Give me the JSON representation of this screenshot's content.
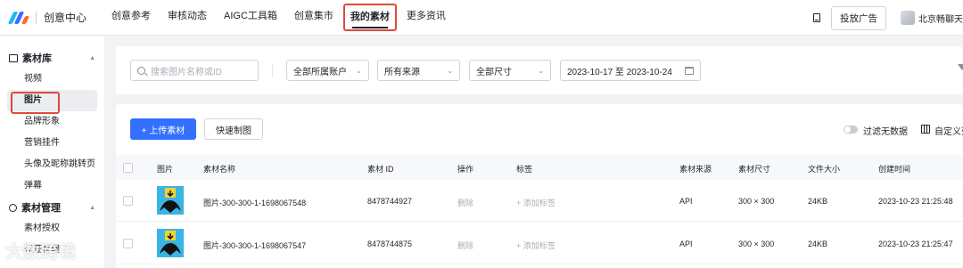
{
  "app": {
    "title": "创意中心",
    "colors": {
      "accent": "#3370ff",
      "highlight": "#e0483b",
      "logo": [
        "#1fb6ff",
        "#3370ff",
        "#fe6b33"
      ]
    }
  },
  "nav": {
    "items": [
      {
        "label": "创意参考"
      },
      {
        "label": "审核动态"
      },
      {
        "label": "AIGC工具箱"
      },
      {
        "label": "创意集市"
      },
      {
        "label": "我的素材",
        "active": true
      },
      {
        "label": "更多资讯"
      }
    ]
  },
  "header_right": {
    "device_icon": "tablet-icon",
    "ad_button": "投放广告",
    "account_name": "北京畅聊天下"
  },
  "sidebar": {
    "sections": [
      {
        "label": "素材库",
        "icon": "image-icon",
        "items": [
          {
            "label": "视频"
          },
          {
            "label": "图片",
            "active": true
          },
          {
            "label": "品牌形象"
          },
          {
            "label": "营销挂件"
          },
          {
            "label": "头像及昵称跳转页"
          },
          {
            "label": "弹幕"
          }
        ]
      },
      {
        "label": "素材管理",
        "icon": "gear-icon",
        "items": [
          {
            "label": "素材授权"
          },
          {
            "label": "标签管理"
          }
        ]
      }
    ]
  },
  "filters": {
    "search_placeholder": "搜索图片名称或ID",
    "account": "全部所属账户",
    "source": "所有来源",
    "size": "全部尺寸",
    "date_range": "2023-10-17 至 2023-10-24"
  },
  "toolbar": {
    "upload_label": "+ 上传素材",
    "quick_label": "快速制图",
    "filter_toggle_label": "过滤无数据",
    "custom_columns_label": "自定义列"
  },
  "table": {
    "headers": [
      "图片",
      "素材名称",
      "素材 ID",
      "操作",
      "标签",
      "素材来源",
      "素材尺寸",
      "文件大小",
      "创建时间"
    ],
    "rows": [
      {
        "name": "图片-300-300-1-1698067548",
        "id": "8478744927",
        "action": "删除",
        "tag": "+ 添加标签",
        "source": "API",
        "dimensions": "300 × 300",
        "file_size": "24KB",
        "created": "2023-10-23 21:25:48"
      },
      {
        "name": "图片-300-300-1-1698067547",
        "id": "8478744875",
        "action": "删除",
        "tag": "+ 添加标签",
        "source": "API",
        "dimensions": "300 × 300",
        "file_size": "24KB",
        "created": "2023-10-23 21:25:47"
      }
    ]
  },
  "watermark": "大数跨境"
}
